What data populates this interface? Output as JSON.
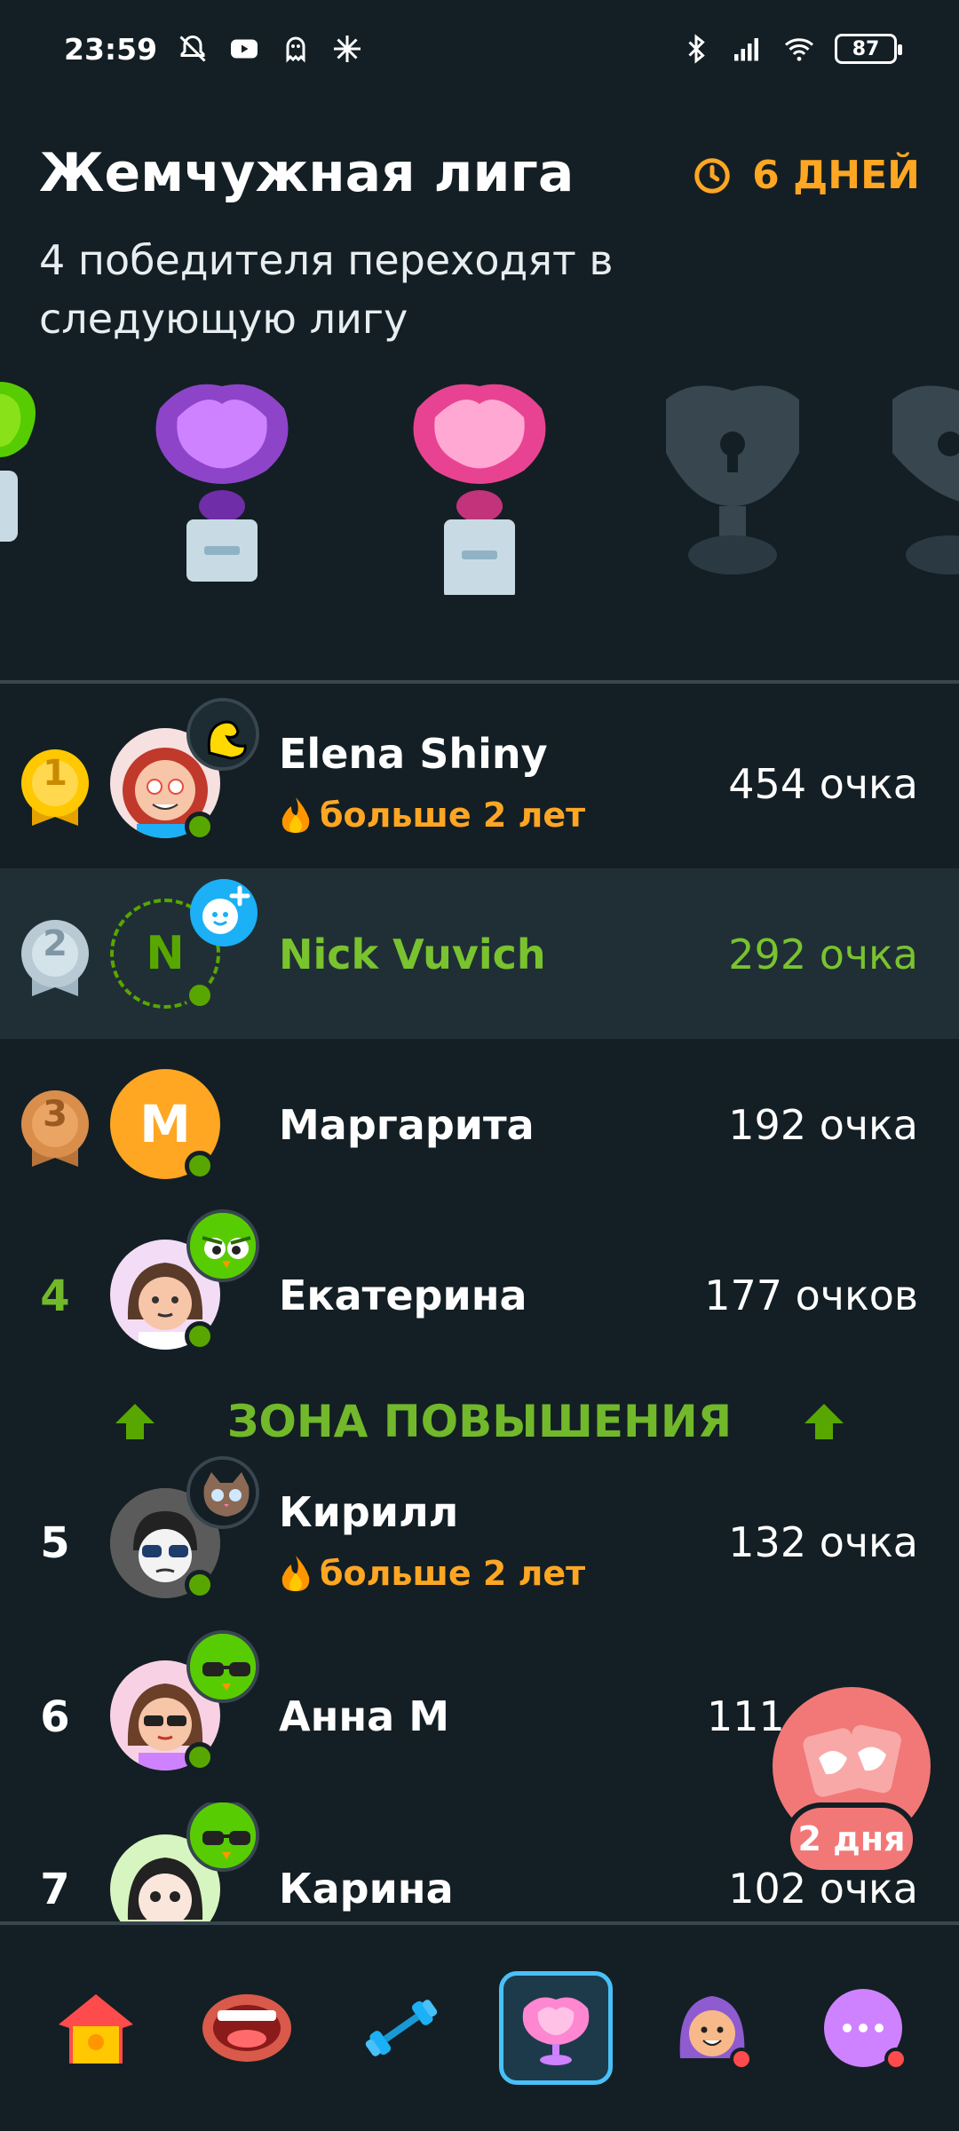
{
  "status_bar": {
    "time": "23:59",
    "battery": "87"
  },
  "header": {
    "title": "Жемчужная лига",
    "days_left": "6 ДНЕЙ",
    "subtitle": "4 победителя переходят в следующую лигу"
  },
  "leaderboard": [
    {
      "rank": "1",
      "name": "Elena Shiny",
      "streak": "больше 2 лет",
      "points": "454 очка"
    },
    {
      "rank": "2",
      "name": "Nick Vuvich",
      "initial": "N",
      "points": "292 очка"
    },
    {
      "rank": "3",
      "name": "Маргарита",
      "initial": "M",
      "points": "192 очка"
    },
    {
      "rank": "4",
      "name": "Екатерина",
      "points": "177 очков"
    },
    {
      "rank": "5",
      "name": "Кирилл",
      "streak": "больше 2 лет",
      "points": "132 очка"
    },
    {
      "rank": "6",
      "name": "Анна М",
      "points": "111 очков"
    },
    {
      "rank": "7",
      "name": "Карина",
      "points": "102 очка"
    }
  ],
  "promotion_zone": "ЗОНА ПОВЫШЕНИЯ",
  "fab": {
    "label": "2 дня"
  },
  "colors": {
    "background": "#131f24",
    "accent_green": "#58a700",
    "accent_orange": "#ffa623",
    "active_border": "#49c0f8"
  }
}
